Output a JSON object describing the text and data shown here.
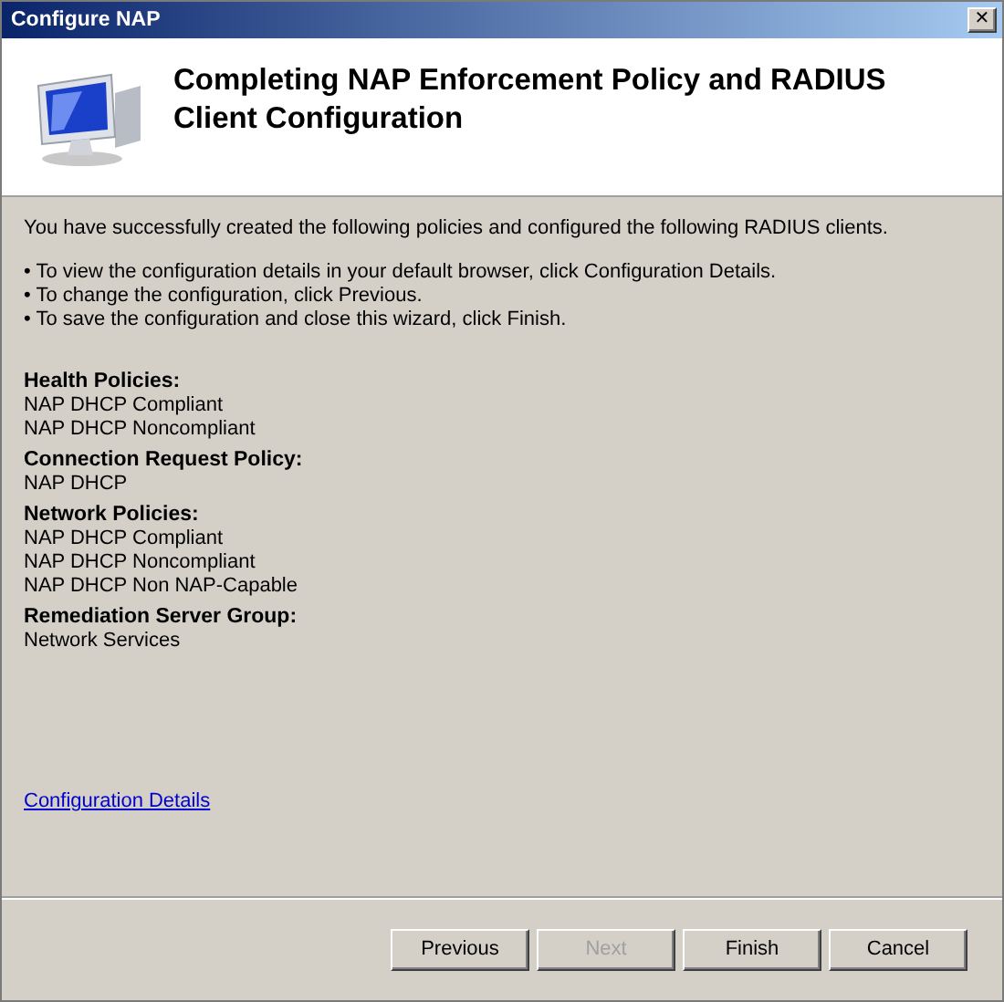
{
  "window": {
    "title": "Configure NAP",
    "close": "✕"
  },
  "header": {
    "title": "Completing NAP Enforcement Policy and RADIUS Client Configuration"
  },
  "intro": "You have successfully created the following policies and configured the following RADIUS clients.",
  "bullets": [
    "• To view the configuration details in your default browser, click Configuration Details.",
    "• To change the configuration, click Previous.",
    "• To save the configuration and close this wizard, click Finish."
  ],
  "sections": [
    {
      "heading": "Health Policies:",
      "items": [
        "NAP DHCP Compliant",
        "NAP DHCP Noncompliant"
      ]
    },
    {
      "heading": "Connection Request Policy:",
      "items": [
        "NAP DHCP"
      ]
    },
    {
      "heading": "Network Policies:",
      "items": [
        "NAP DHCP Compliant",
        "NAP DHCP Noncompliant",
        "NAP DHCP Non NAP-Capable"
      ]
    },
    {
      "heading": "Remediation Server Group:",
      "items": [
        "Network Services"
      ]
    }
  ],
  "link": "Configuration Details",
  "buttons": [
    {
      "label": "Previous",
      "disabled": false
    },
    {
      "label": "Next",
      "disabled": true
    },
    {
      "label": "Finish",
      "disabled": false
    },
    {
      "label": "Cancel",
      "disabled": false
    }
  ]
}
